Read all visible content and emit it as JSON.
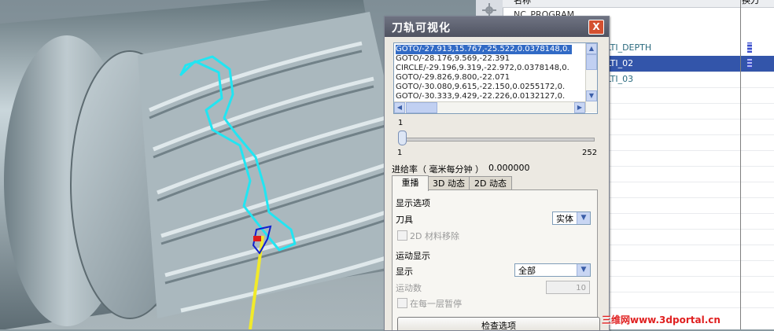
{
  "dialog": {
    "title": "刀轨可视化",
    "close_label": "X",
    "path_list": [
      "GOTO/-27.913,15.767,-25.522,0.0378148,0.",
      "GOTO/-28.176,9.569,-22.391",
      "CIRCLE/-29.196,9.319,-22.972,0.0378148,0.",
      "GOTO/-29.826,9.800,-22.071",
      "GOTO/-30.080,9.615,-22.150,0.0255172,0.",
      "GOTO/-30.333,9.429,-22.226,0.0132127,0."
    ],
    "slider": {
      "value_label": "1",
      "min": "1",
      "max": "252",
      "fraction": 0.0
    },
    "feed_label": "进给率（ 毫米每分钟 ）",
    "feed_value": "0.000000",
    "tabs": [
      "重播",
      "3D 动态",
      "2D 动态"
    ],
    "display_options": {
      "section": "显示选项",
      "tool_label": "刀具",
      "tool_value": "实体",
      "material_removal": "2D 材料移除"
    },
    "motion_display": {
      "section": "运动显示",
      "display_label": "显示",
      "display_value": "全部",
      "count_label": "运动数",
      "count_value": "10",
      "pause_label": "在每一层暂停"
    },
    "check_button": "检查选项"
  },
  "navigator": {
    "header_name": "名称",
    "header_tool": "换刀",
    "rows": [
      {
        "name": "NC_PROGRAM",
        "selected": false,
        "indicator": false
      },
      {
        "name": "LTI_DEPTH",
        "selected": false,
        "indicator": true
      },
      {
        "name": "LTI_02",
        "selected": true,
        "indicator": true
      },
      {
        "name": "LTI_03",
        "selected": false,
        "indicator": false
      }
    ]
  },
  "watermark": "三维网www.3dportal.cn",
  "colors": {
    "toolpath": "#22e5f2",
    "selection": "#316ac5",
    "title_bar": "#5a5e6c"
  }
}
